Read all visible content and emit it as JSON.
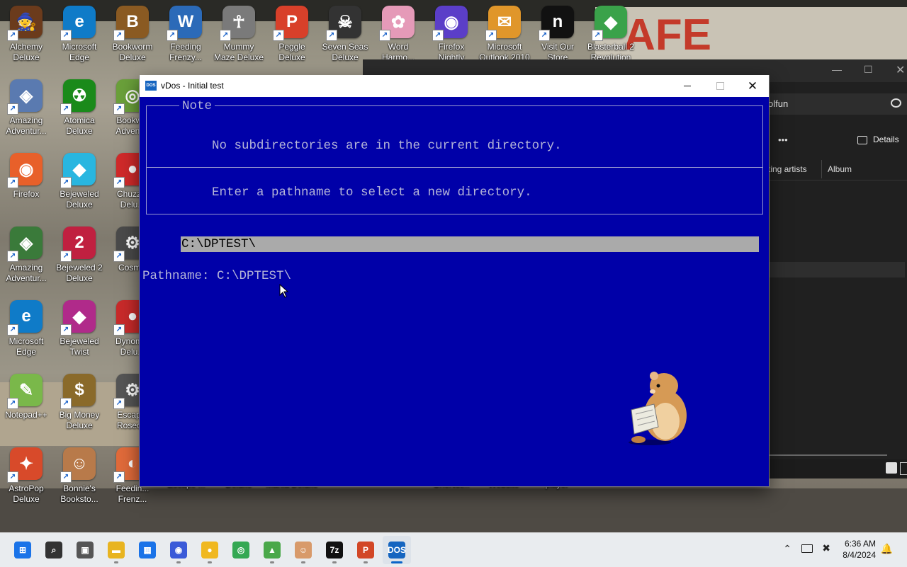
{
  "desktop": {
    "icons": [
      {
        "label": "Alchemy Deluxe",
        "color": "#6b3b1c",
        "glyph": "🧙"
      },
      {
        "label": "Microsoft Edge",
        "color": "#0f7bc8",
        "glyph": "e"
      },
      {
        "label": "Bookworm Deluxe",
        "color": "#8a5a22",
        "glyph": "B"
      },
      {
        "label": "Feeding Frenzy...",
        "color": "#2b6ab8",
        "glyph": "W"
      },
      {
        "label": "Mummy Maze Deluxe",
        "color": "#7a7a7a",
        "glyph": "☥"
      },
      {
        "label": "Peggle Deluxe",
        "color": "#d8402a",
        "glyph": "P"
      },
      {
        "label": "Seven Seas Deluxe",
        "color": "#333333",
        "glyph": "☠"
      },
      {
        "label": "Word Harmo...",
        "color": "#e59ab8",
        "glyph": "✿"
      },
      {
        "label": "Firefox Nightly",
        "color": "#5b3ec8",
        "glyph": "◉"
      },
      {
        "label": "Microsoft Outlook 2010",
        "color": "#e0962a",
        "glyph": "✉"
      },
      {
        "label": "Visit Our Store",
        "color": "#111111",
        "glyph": "n"
      },
      {
        "label": "Blasterball 2 Revolution",
        "color": "#3aa24a",
        "glyph": "◆"
      },
      {
        "label": "Amazing Adventur...",
        "color": "#5a7ab0",
        "glyph": "◈"
      },
      {
        "label": "Atomica Deluxe",
        "color": "#1a8a1a",
        "glyph": "☢"
      },
      {
        "label": "Bookw... Advent...",
        "color": "#6aa03a",
        "glyph": "◎"
      },
      {
        "label": "Firefox",
        "color": "#e8602a",
        "glyph": "◉"
      },
      {
        "label": "Bejeweled Deluxe",
        "color": "#29b6e0",
        "glyph": "◆"
      },
      {
        "label": "Chuzz... Delu...",
        "color": "#d02a2a",
        "glyph": "●"
      },
      {
        "label": "Amazing Adventur...",
        "color": "#3a7a3a",
        "glyph": "◈"
      },
      {
        "label": "Bejeweled 2 Deluxe",
        "color": "#c02040",
        "glyph": "2"
      },
      {
        "label": "Cosmic",
        "color": "#4a4a4a",
        "glyph": "⚙"
      },
      {
        "label": "Microsoft Edge",
        "color": "#0f7bc8",
        "glyph": "e"
      },
      {
        "label": "Bejeweled Twist",
        "color": "#b02a8a",
        "glyph": "◆"
      },
      {
        "label": "Dynom... Delu...",
        "color": "#c82a2a",
        "glyph": "●"
      },
      {
        "label": "Notepad++",
        "color": "#7ab84a",
        "glyph": "✎"
      },
      {
        "label": "Big Money Deluxe",
        "color": "#8a6a2a",
        "glyph": "$"
      },
      {
        "label": "Escap... Rosec...",
        "color": "#555555",
        "glyph": "⚙"
      },
      {
        "label": "AstroPop Deluxe",
        "color": "#d84a2a",
        "glyph": "✦"
      },
      {
        "label": "Bonnie's Booksto...",
        "color": "#b87a4a",
        "glyph": "☺"
      },
      {
        "label": "Feedin... Frenz...",
        "color": "#e06a3a",
        "glyph": "◐"
      }
    ],
    "partial_labels": [
      "Escape ...",
      "Deluxe",
      "Mania Deluxe",
      "OneNot...",
      "Website",
      "player"
    ]
  },
  "explorer": {
    "search_text": "olfun",
    "details_label": "Details",
    "more_label": "•••",
    "columns": [
      "ting artists",
      "Album"
    ]
  },
  "vdos": {
    "title": "vDos - Initial test",
    "app_icon_text": "DOS",
    "note_title": "Note",
    "message1": "No subdirectories are in the current directory.",
    "message2": "Enter a pathname to select a new directory.",
    "highlight_path": "C:\\DPTEST\\",
    "pathname_prompt": "Pathname: C:\\DPTEST\\"
  },
  "taskbar": {
    "apps": [
      {
        "name": "start",
        "color": "#1a73e8",
        "glyph": "⊞"
      },
      {
        "name": "search",
        "color": "#333333",
        "glyph": "⌕"
      },
      {
        "name": "task-view",
        "color": "#555555",
        "glyph": "▣"
      },
      {
        "name": "file-explorer",
        "color": "#e8b420",
        "glyph": "▬"
      },
      {
        "name": "store",
        "color": "#1a73e8",
        "glyph": "▦"
      },
      {
        "name": "firefox-nightly",
        "color": "#3a5ad8",
        "glyph": "◉"
      },
      {
        "name": "norton",
        "color": "#f0b820",
        "glyph": "●"
      },
      {
        "name": "chrome",
        "color": "#34a853",
        "glyph": "◎"
      },
      {
        "name": "app-green",
        "color": "#4aa84a",
        "glyph": "▲"
      },
      {
        "name": "app-face",
        "color": "#d89a6a",
        "glyph": "☺"
      },
      {
        "name": "7zip",
        "color": "#111111",
        "glyph": "7z"
      },
      {
        "name": "powerpoint",
        "color": "#d24726",
        "glyph": "P"
      },
      {
        "name": "vdos",
        "color": "#1565c0",
        "glyph": "DOS"
      }
    ],
    "time": "6:36 AM",
    "date": "8/4/2024"
  }
}
